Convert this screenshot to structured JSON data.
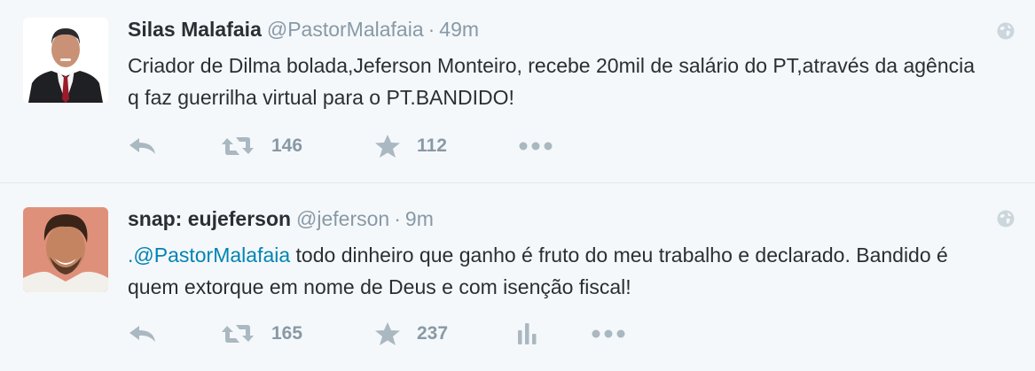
{
  "tweets": [
    {
      "name": "Silas Malafaia",
      "handle": "@PastorMalafaia",
      "separator": "·",
      "time": "49m",
      "text": "Criador de Dilma bolada,Jeferson Monteiro, recebe 20mil de salário do PT,através da agência q faz guerrilha virtual para o PT.BANDIDO!",
      "retweets": "146",
      "favorites": "112",
      "icons": [
        "reply-icon",
        "retweet-icon",
        "favorite-icon",
        "more-icon",
        "globe-icon"
      ]
    },
    {
      "name": "snap: eujeferson",
      "handle": "@jeferson",
      "separator": "·",
      "time": "9m",
      "text_mention": ".@PastorMalafaia",
      "text_rest": " todo dinheiro que ganho é fruto do meu trabalho e declarado. Bandido é quem extorque em nome de Deus e com isenção fiscal!",
      "retweets": "165",
      "favorites": "237",
      "icons": [
        "reply-icon",
        "retweet-icon",
        "favorite-icon",
        "stats-icon",
        "more-icon",
        "globe-icon"
      ]
    }
  ],
  "colors": {
    "background": "#f5f8fa",
    "text": "#292f33",
    "muted": "#8899a6",
    "icon": "#aab8c2",
    "link": "#0084b4"
  }
}
